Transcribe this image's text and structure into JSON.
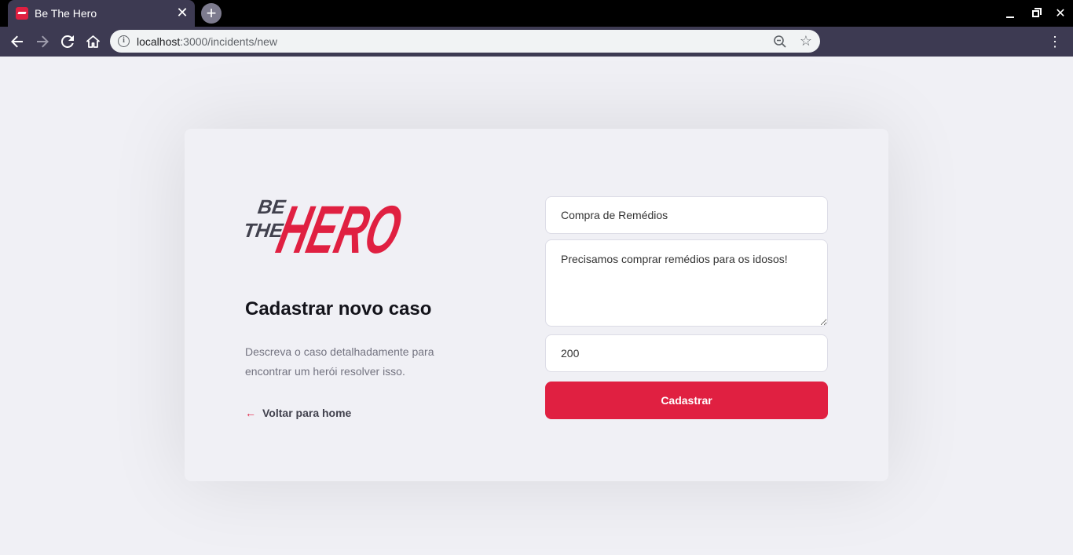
{
  "browser": {
    "tab_title": "Be The Hero",
    "tab_close": "✕",
    "new_tab": "+",
    "url_host": "localhost",
    "url_path": ":3000/incidents/new",
    "info_icon": "i",
    "star_icon": "☆",
    "menu_icon": "⋮"
  },
  "logo": {
    "line1": "BE",
    "line2": "THE",
    "word": "HERO",
    "brand_color": "#e02041",
    "dark_color": "#41414d"
  },
  "page": {
    "title": "Cadastrar novo caso",
    "description": "Descreva o caso detalhadamente para encontrar um herói resolver isso.",
    "back_arrow": "←",
    "back_link": "Voltar para home"
  },
  "form": {
    "title_value": "Compra de Remédios",
    "description_value": "Precisamos comprar remédios para os idosos!",
    "value_value": "200",
    "submit_label": "Cadastrar"
  }
}
